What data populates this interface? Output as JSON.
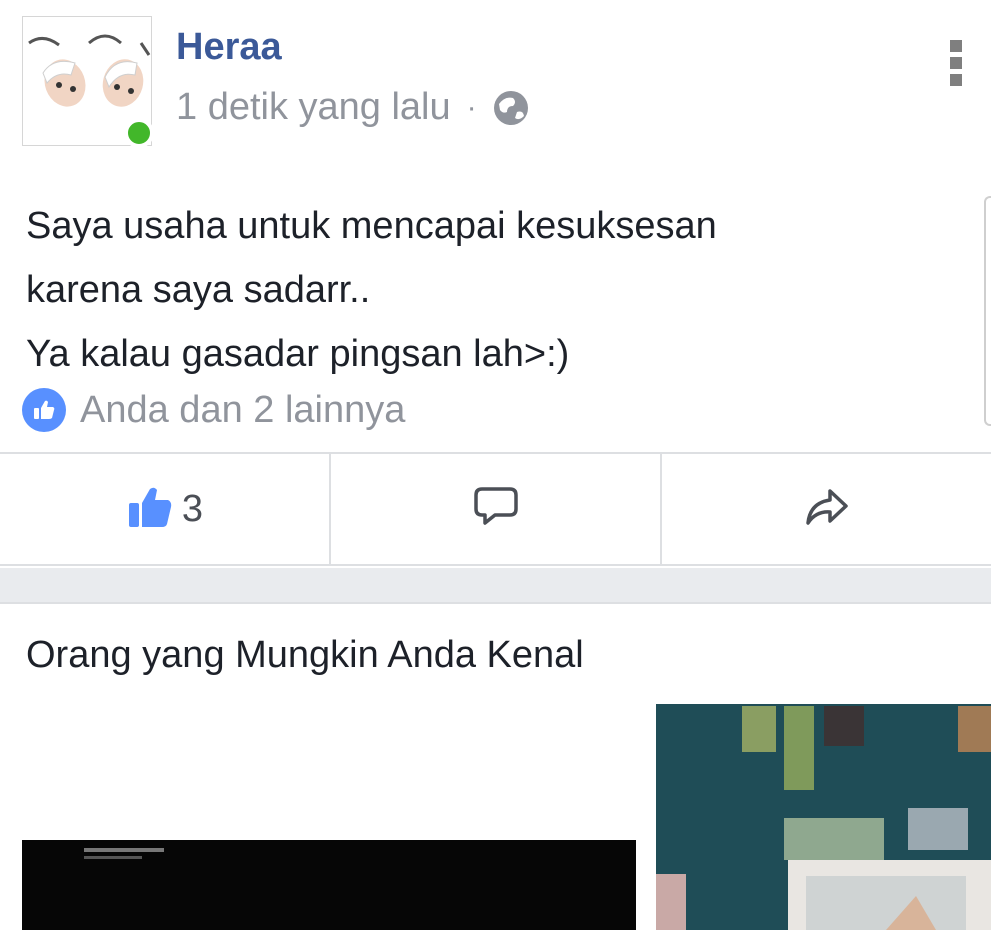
{
  "post": {
    "author_name": "Heraa",
    "timestamp": "1 detik yang lalu",
    "separator_dot": "·",
    "privacy_icon": "globe-icon",
    "more_icon": "more-vertical-icon",
    "text_lines": [
      "Saya usaha untuk mencapai kesuksesan",
      "karena saya sadarr..",
      "Ya kalau gasadar pingsan lah>:)"
    ],
    "reaction_summary": "Anda dan 2 lainnya",
    "reaction_icon": "like-badge-icon"
  },
  "actions": {
    "like_icon": "thumbs-up-icon",
    "like_count": "3",
    "comment_icon": "comment-icon",
    "share_icon": "share-icon"
  },
  "pymk": {
    "title": "Orang yang Mungkin Anda Kenal"
  },
  "colors": {
    "brand_blue": "#3b5998",
    "like_blue": "#5890ff",
    "online_green": "#42b72a",
    "meta_gray": "#90949c",
    "divider": "#dddfe2",
    "feed_bg": "#e9ebee"
  }
}
